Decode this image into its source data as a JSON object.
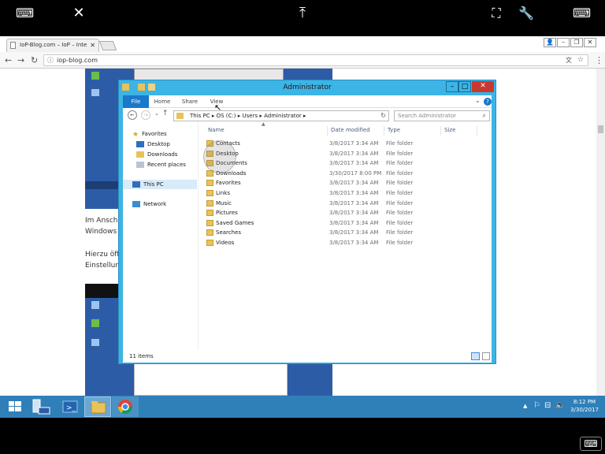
{
  "browser": {
    "tab_title": "IoP-Blog.com – IoP – Inte",
    "url": "iop-blog.com"
  },
  "article": {
    "line1": "Im Ansch",
    "line2": "Windows",
    "line3": "Hierzu öff",
    "line4": "Einstellun"
  },
  "explorer": {
    "title": "Administrator",
    "ribbon_tabs": [
      "File",
      "Home",
      "Share",
      "View"
    ],
    "breadcrumb": [
      "This PC",
      "OS (C:)",
      "Users",
      "Administrator"
    ],
    "search_placeholder": "Search Administrator",
    "nav": {
      "favorites": "Favorites",
      "desktop": "Desktop",
      "downloads": "Downloads",
      "recent": "Recent places",
      "this_pc": "This PC",
      "network": "Network"
    },
    "columns": [
      "Name",
      "Date modified",
      "Type",
      "Size"
    ],
    "files": [
      {
        "name": "Contacts",
        "date": "3/8/2017 3:34 AM",
        "type": "File folder"
      },
      {
        "name": "Desktop",
        "date": "3/8/2017 3:34 AM",
        "type": "File folder"
      },
      {
        "name": "Documents",
        "date": "3/8/2017 3:34 AM",
        "type": "File folder"
      },
      {
        "name": "Downloads",
        "date": "3/30/2017 8:00 PM",
        "type": "File folder"
      },
      {
        "name": "Favorites",
        "date": "3/8/2017 3:34 AM",
        "type": "File folder"
      },
      {
        "name": "Links",
        "date": "3/8/2017 3:34 AM",
        "type": "File folder"
      },
      {
        "name": "Music",
        "date": "3/8/2017 3:34 AM",
        "type": "File folder"
      },
      {
        "name": "Pictures",
        "date": "3/8/2017 3:34 AM",
        "type": "File folder"
      },
      {
        "name": "Saved Games",
        "date": "3/8/2017 3:34 AM",
        "type": "File folder"
      },
      {
        "name": "Searches",
        "date": "3/8/2017 3:34 AM",
        "type": "File folder"
      },
      {
        "name": "Videos",
        "date": "3/8/2017 3:34 AM",
        "type": "File folder"
      }
    ],
    "status": "11 items"
  },
  "taskbar": {
    "time": "8:12 PM",
    "date": "3/30/2017"
  },
  "colors": {
    "explorer_frame": "#3cb4e6",
    "taskbar": "#2f7fb8",
    "file_tab": "#1979ca",
    "folder": "#e9c25a"
  }
}
